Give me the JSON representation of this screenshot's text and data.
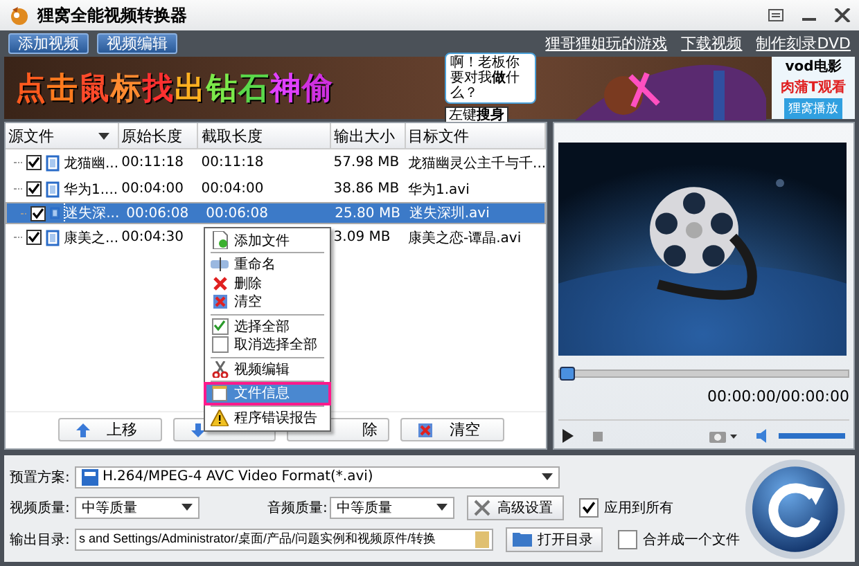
{
  "window": {
    "title": "狸窝全能视频转换器"
  },
  "toolbar": {
    "buttons": [
      "添加视频",
      "视频编辑"
    ],
    "links": [
      "狸哥狸姐玩的游戏",
      "下载视频",
      "制作刻录DVD"
    ]
  },
  "banner": {
    "headline": [
      "点",
      "击",
      "鼠",
      "标",
      "找",
      "出",
      "钻",
      "石",
      "神",
      "偷"
    ],
    "bubble": "啊！老板你要对我**做**什么？",
    "hint": "左键**搜身**",
    "side": [
      "vod电影",
      "肉蒲T观看"
    ],
    "side_button": "狸窝播放"
  },
  "table": {
    "columns": [
      "源文件",
      "原始长度",
      "截取长度",
      "输出大小",
      "目标文件"
    ],
    "rows": [
      {
        "checked": true,
        "selected": false,
        "cells": [
          "龙猫幽...",
          "00:11:18",
          "00:11:18",
          "57.98 MB",
          "龙猫幽灵公主千与千..."
        ]
      },
      {
        "checked": true,
        "selected": false,
        "cells": [
          "华为1....",
          "00:04:00",
          "00:04:00",
          "38.86 MB",
          "华为1.avi"
        ]
      },
      {
        "checked": true,
        "selected": true,
        "cells": [
          "迷失深...",
          "00:06:08",
          "00:06:08",
          "25.80 MB",
          "迷失深圳.avi"
        ]
      },
      {
        "checked": true,
        "selected": false,
        "cells": [
          "康美之...",
          "00:04:30",
          "",
          "3.09 MB",
          "康美之恋-谭晶.avi"
        ]
      }
    ]
  },
  "list_buttons": [
    {
      "kind": "up",
      "label": "上移"
    },
    {
      "kind": "down"
    },
    {
      "kind": "delete",
      "label": "除"
    },
    {
      "kind": "clear",
      "label": "清空"
    }
  ],
  "context_menu": {
    "groups": [
      [
        {
          "label": "添加文件",
          "selected": false
        }
      ],
      [
        {
          "label": "重命名",
          "selected": false
        },
        {
          "label": "删除",
          "selected": false
        },
        {
          "label": "清空",
          "selected": false
        }
      ],
      [
        {
          "label": "选择全部",
          "selected": false,
          "checked": true
        },
        {
          "label": "取消选择全部",
          "selected": false,
          "checked": false
        }
      ],
      [
        {
          "label": "视频编辑",
          "selected": false
        }
      ],
      [
        {
          "label": "文件信息",
          "selected": true
        }
      ],
      [
        {
          "label": "程序错误报告",
          "selected": false
        }
      ]
    ]
  },
  "preview": {
    "progress": {
      "level": 0
    },
    "time": "00:00:00/00:00:00",
    "volume": {
      "level": 1
    }
  },
  "settings": {
    "preset_label": "预置方案:",
    "preset": "H.264/MPEG-4 AVC Video Format(*.avi)",
    "video_quality_label": "视频质量:",
    "video_quality": "中等质量",
    "audio_quality_label": "音频质量:",
    "audio_quality": "中等质量",
    "advanced_button": "高级设置",
    "apply_all": {
      "label": "应用到所有",
      "checked": true
    },
    "output_label": "输出目录:",
    "output_dir": "s and Settings/Administrator/桌面/产品/问题实例和视频原件/转换",
    "open_button": "打开目录",
    "merge": {
      "label": "合并成一个文件",
      "checked": false
    }
  }
}
